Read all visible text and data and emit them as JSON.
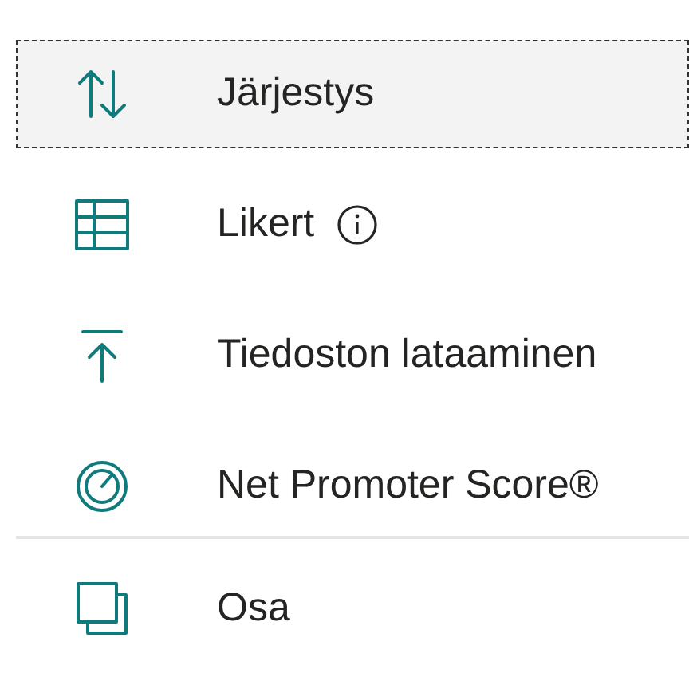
{
  "menu": {
    "items": [
      {
        "kind": "sort",
        "label": "Järjestys",
        "selected": true,
        "info": false
      },
      {
        "kind": "likert",
        "label": "Likert",
        "selected": false,
        "info": true
      },
      {
        "kind": "upload",
        "label": "Tiedoston lataaminen",
        "selected": false,
        "info": false
      },
      {
        "kind": "nps",
        "label": "Net Promoter Score®",
        "selected": false,
        "info": false
      },
      {
        "kind": "divider"
      },
      {
        "kind": "section",
        "label": "Osa",
        "selected": false,
        "info": false
      }
    ]
  }
}
